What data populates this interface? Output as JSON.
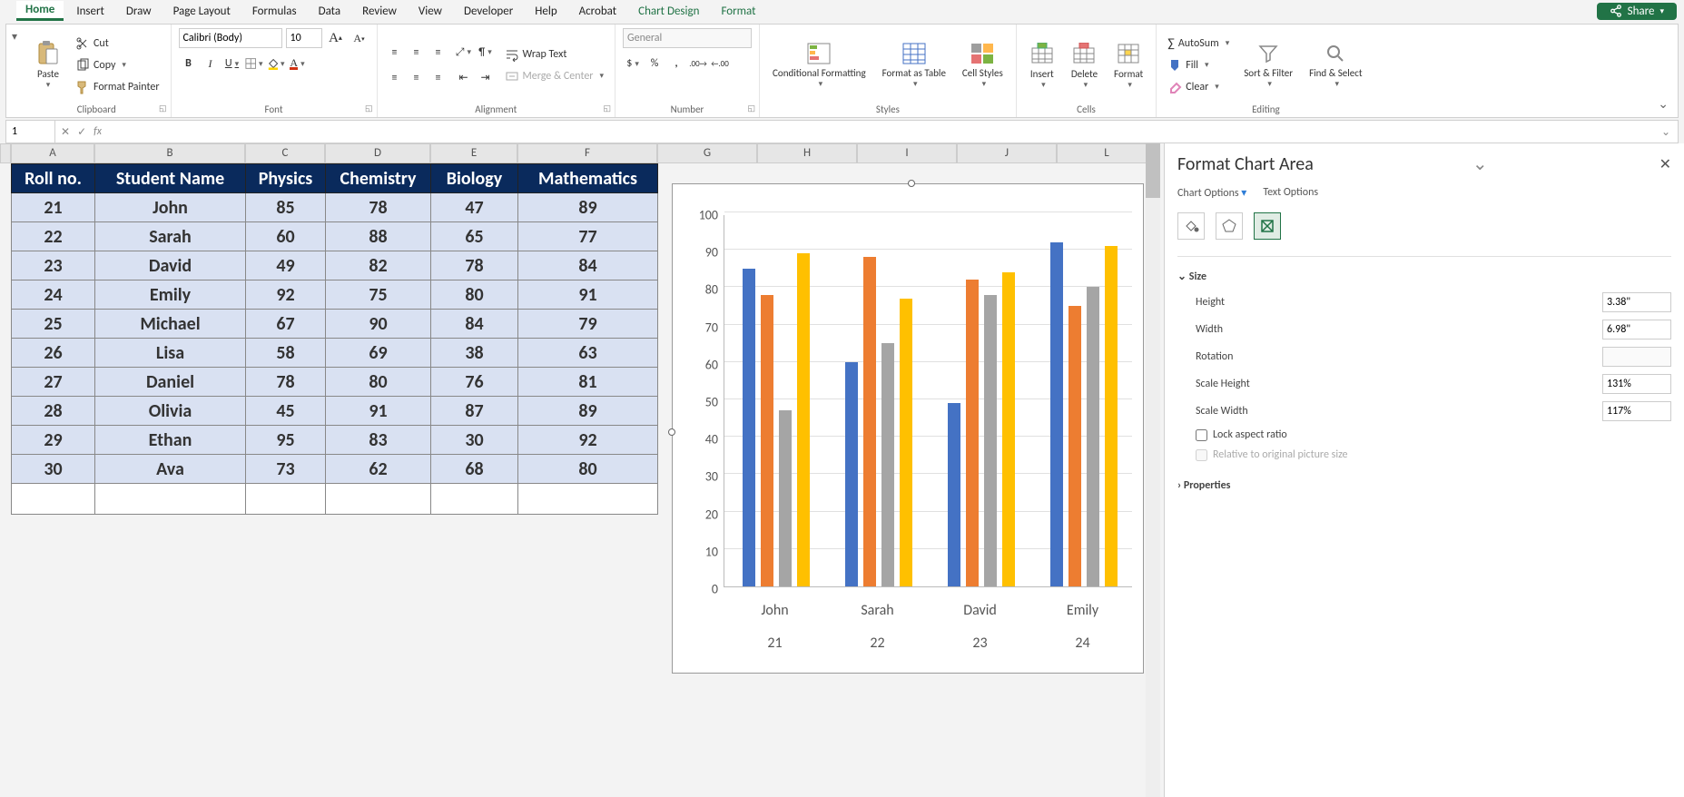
{
  "tabs": [
    "Home",
    "Insert",
    "Draw",
    "Page Layout",
    "Formulas",
    "Data",
    "Review",
    "View",
    "Developer",
    "Help",
    "Acrobat",
    "Chart Design",
    "Format"
  ],
  "active_tab": "Home",
  "share_label": "Share",
  "ribbon": {
    "clipboard": {
      "paste": "Paste",
      "cut": "Cut",
      "copy": "Copy",
      "format_painter": "Format Painter",
      "label": "Clipboard"
    },
    "font": {
      "name": "Calibri (Body)",
      "size": "10",
      "label": "Font"
    },
    "alignment": {
      "wrap": "Wrap Text",
      "merge": "Merge & Center",
      "label": "Alignment"
    },
    "number": {
      "format": "General",
      "label": "Number"
    },
    "styles": {
      "cond": "Conditional Formatting",
      "fmt_table": "Format as Table",
      "cell_styles": "Cell Styles",
      "label": "Styles"
    },
    "cells": {
      "insert": "Insert",
      "delete": "Delete",
      "format": "Format",
      "label": "Cells"
    },
    "editing": {
      "autosum": "AutoSum",
      "fill": "Fill",
      "clear": "Clear",
      "sort": "Sort & Filter",
      "find": "Find & Select",
      "label": "Editing"
    }
  },
  "namebox": "1",
  "columns": [
    "A",
    "B",
    "C",
    "D",
    "E",
    "F",
    "G",
    "H",
    "I",
    "J",
    "L"
  ],
  "table": {
    "headers": [
      "Roll no.",
      "Student Name",
      "Physics",
      "Chemistry",
      "Biology",
      "Mathematics"
    ],
    "rows": [
      [
        "21",
        "John",
        "85",
        "78",
        "47",
        "89"
      ],
      [
        "22",
        "Sarah",
        "60",
        "88",
        "65",
        "77"
      ],
      [
        "23",
        "David",
        "49",
        "82",
        "78",
        "84"
      ],
      [
        "24",
        "Emily",
        "92",
        "75",
        "80",
        "91"
      ],
      [
        "25",
        "Michael",
        "67",
        "90",
        "84",
        "79"
      ],
      [
        "26",
        "Lisa",
        "58",
        "69",
        "38",
        "63"
      ],
      [
        "27",
        "Daniel",
        "78",
        "80",
        "76",
        "81"
      ],
      [
        "28",
        "Olivia",
        "45",
        "91",
        "87",
        "89"
      ],
      [
        "29",
        "Ethan",
        "95",
        "83",
        "30",
        "92"
      ],
      [
        "30",
        "Ava",
        "73",
        "62",
        "68",
        "80"
      ]
    ]
  },
  "chart_data": {
    "type": "bar",
    "categories": [
      "John",
      "Sarah",
      "David",
      "Emily"
    ],
    "subcategories": [
      "21",
      "22",
      "23",
      "24"
    ],
    "series": [
      {
        "name": "Physics",
        "color": "#4472c4",
        "values": [
          85,
          60,
          49,
          92
        ]
      },
      {
        "name": "Chemistry",
        "color": "#ed7d31",
        "values": [
          78,
          88,
          82,
          75
        ]
      },
      {
        "name": "Biology",
        "color": "#a5a5a5",
        "values": [
          47,
          65,
          78,
          80
        ]
      },
      {
        "name": "Mathematics",
        "color": "#ffc000",
        "values": [
          89,
          77,
          84,
          91
        ]
      }
    ],
    "ylim": [
      0,
      100
    ],
    "ytick_step": 10
  },
  "task_pane": {
    "title": "Format Chart Area",
    "tab1": "Chart Options",
    "tab2": "Text Options",
    "size_label": "Size",
    "height_label": "Height",
    "height_val": "3.38\"",
    "width_label": "Width",
    "width_val": "6.98\"",
    "rotation_label": "Rotation",
    "rotation_val": "",
    "scale_h_label": "Scale Height",
    "scale_h_val": "131%",
    "scale_w_label": "Scale Width",
    "scale_w_val": "117%",
    "lock_label": "Lock aspect ratio",
    "relative_label": "Relative to original picture size",
    "properties_label": "Properties"
  }
}
